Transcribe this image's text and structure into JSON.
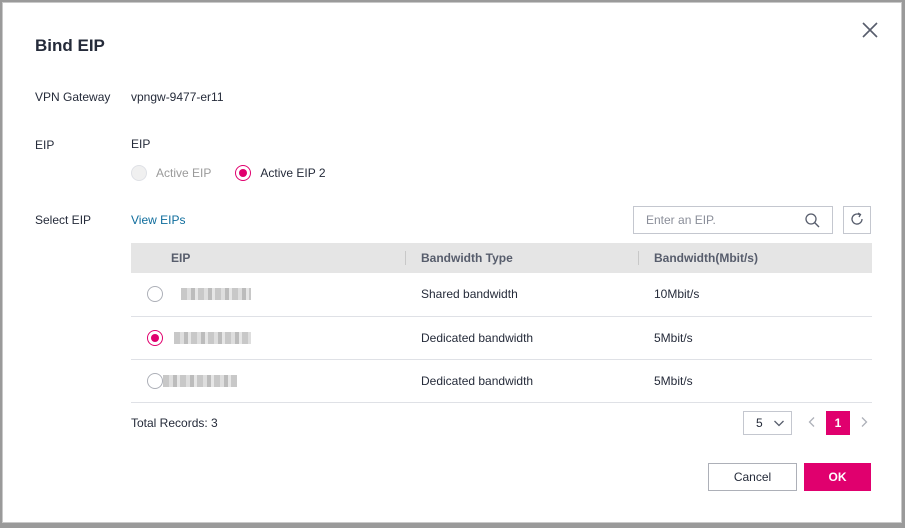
{
  "dialog": {
    "title": "Bind EIP",
    "vpn_gateway_label": "VPN Gateway",
    "vpn_gateway_value": "vpngw-9477-er11",
    "eip_label": "EIP",
    "eip_value": "EIP",
    "eip_options": [
      {
        "label": "Active EIP",
        "state": "disabled"
      },
      {
        "label": "Active EIP 2",
        "state": "selected"
      }
    ],
    "select_eip_label": "Select EIP",
    "view_eips_link": "View EIPs",
    "search_placeholder": "Enter an EIP."
  },
  "table": {
    "columns": [
      "EIP",
      "Bandwidth Type",
      "Bandwidth(Mbit/s)"
    ],
    "rows": [
      {
        "eip": "",
        "bandwidth_type": "Shared bandwidth",
        "bandwidth": "10Mbit/s",
        "selected": false
      },
      {
        "eip": "",
        "bandwidth_type": "Dedicated bandwidth",
        "bandwidth": "5Mbit/s",
        "selected": true
      },
      {
        "eip": "",
        "bandwidth_type": "Dedicated bandwidth",
        "bandwidth": "5Mbit/s",
        "selected": false
      }
    ]
  },
  "footer": {
    "total_records": "Total Records: 3",
    "page_size": "5",
    "current_page": "1",
    "cancel_label": "Cancel",
    "ok_label": "OK"
  },
  "colors": {
    "accent": "#e0006e",
    "link": "#0e6c9c",
    "header_bg": "#e5e5e5"
  }
}
